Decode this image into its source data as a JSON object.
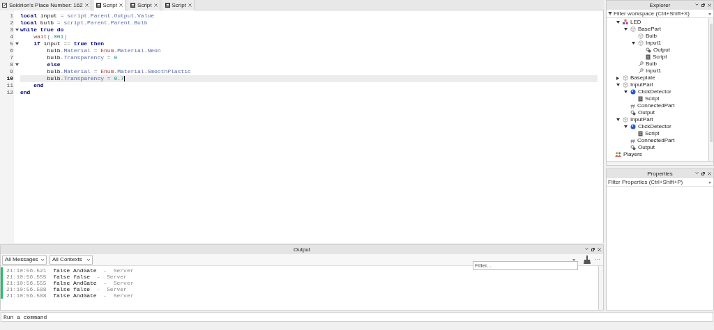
{
  "tabs": [
    {
      "label": "Soldrion's Place Number: 162",
      "kind": "place",
      "selected": false
    },
    {
      "label": "Script",
      "kind": "script",
      "selected": true
    },
    {
      "label": "Script",
      "kind": "script",
      "selected": false
    },
    {
      "label": "Script",
      "kind": "script",
      "selected": false
    }
  ],
  "editor": {
    "lines": [
      {
        "number": "1",
        "fold": false,
        "current": false,
        "tokens": [
          {
            "kind": "keyword",
            "text": "local"
          },
          {
            "kind": "plain",
            "text": " input "
          },
          {
            "kind": "op",
            "text": "="
          },
          {
            "kind": "member",
            "text": " script.Parent.Output.Value"
          }
        ]
      },
      {
        "number": "2",
        "fold": false,
        "current": false,
        "tokens": [
          {
            "kind": "keyword",
            "text": "local"
          },
          {
            "kind": "plain",
            "text": " bulb "
          },
          {
            "kind": "op",
            "text": "="
          },
          {
            "kind": "member",
            "text": " script.Parent.Parent.Bulb"
          }
        ]
      },
      {
        "number": "3",
        "fold": true,
        "current": false,
        "tokens": [
          {
            "kind": "keyword",
            "text": "while true do"
          }
        ]
      },
      {
        "number": "4",
        "fold": false,
        "current": false,
        "tokens": [
          {
            "kind": "builtin",
            "text": "    wait"
          },
          {
            "kind": "op",
            "text": "("
          },
          {
            "kind": "number",
            "text": ".001"
          },
          {
            "kind": "op",
            "text": ")"
          }
        ]
      },
      {
        "number": "5",
        "fold": true,
        "current": false,
        "tokens": [
          {
            "kind": "keyword",
            "text": "    if"
          },
          {
            "kind": "plain",
            "text": " input "
          },
          {
            "kind": "op",
            "text": "=="
          },
          {
            "kind": "keyword",
            "text": " true then"
          }
        ]
      },
      {
        "number": "6",
        "fold": false,
        "current": false,
        "tokens": [
          {
            "kind": "plain",
            "text": "        bulb"
          },
          {
            "kind": "member",
            "text": ".Material "
          },
          {
            "kind": "op",
            "text": "="
          },
          {
            "kind": "builtin",
            "text": " Enum"
          },
          {
            "kind": "member",
            "text": ".Material.Neon"
          }
        ]
      },
      {
        "number": "7",
        "fold": false,
        "current": false,
        "tokens": [
          {
            "kind": "plain",
            "text": "        bulb"
          },
          {
            "kind": "member",
            "text": ".Transparency "
          },
          {
            "kind": "op",
            "text": "="
          },
          {
            "kind": "number",
            "text": " 0"
          }
        ]
      },
      {
        "number": "8",
        "fold": true,
        "current": false,
        "tokens": [
          {
            "kind": "keyword",
            "text": "        else"
          }
        ]
      },
      {
        "number": "9",
        "fold": false,
        "current": false,
        "tokens": [
          {
            "kind": "plain",
            "text": "        bulb"
          },
          {
            "kind": "member",
            "text": ".Material "
          },
          {
            "kind": "op",
            "text": "="
          },
          {
            "kind": "builtin",
            "text": " Enum"
          },
          {
            "kind": "member",
            "text": ".Material.SmoothPlastic"
          }
        ]
      },
      {
        "number": "10",
        "fold": false,
        "current": true,
        "tokens": [
          {
            "kind": "plain",
            "text": "        bulb"
          },
          {
            "kind": "member",
            "text": ".Transparency "
          },
          {
            "kind": "op",
            "text": "="
          },
          {
            "kind": "number",
            "text": " 0.7"
          }
        ]
      },
      {
        "number": "11",
        "fold": false,
        "current": false,
        "tokens": [
          {
            "kind": "keyword",
            "text": "    end"
          }
        ]
      },
      {
        "number": "12",
        "fold": false,
        "current": false,
        "tokens": [
          {
            "kind": "keyword",
            "text": "end"
          }
        ]
      }
    ]
  },
  "output": {
    "title": "Output",
    "message_filter": "All Messages",
    "context_filter": "All Contexts",
    "filter_placeholder": "Filter...",
    "more": "···",
    "entries": [
      {
        "time": "21:10:56.521",
        "message": "false AndGate",
        "separator": "-",
        "source": "Server"
      },
      {
        "time": "21:10:56.555",
        "message": "false false",
        "separator": "-",
        "source": "Server"
      },
      {
        "time": "21:10:56.555",
        "message": "false AndGate",
        "separator": "-",
        "source": "Server"
      },
      {
        "time": "21:10:56.588",
        "message": "false false",
        "separator": "-",
        "source": "Server"
      },
      {
        "time": "21:10:56.588",
        "message": "false AndGate",
        "separator": "-",
        "source": "Server"
      }
    ]
  },
  "command_bar": {
    "placeholder": "Run a command"
  },
  "explorer": {
    "title": "Explorer",
    "filter_placeholder": "Filter workspace (Ctrl+Shift+X)",
    "workspace_children": [
      {
        "label": "LED",
        "kind": "model",
        "expanded": true,
        "children": [
          {
            "label": "BasePart",
            "kind": "part",
            "expanded": true,
            "children": [
              {
                "label": "Bulb",
                "kind": "part"
              },
              {
                "label": "Input1",
                "kind": "part",
                "expanded": true,
                "children": [
                  {
                    "label": "Output",
                    "kind": "value"
                  },
                  {
                    "label": "Script",
                    "kind": "script"
                  }
                ]
              },
              {
                "label": "Bulb",
                "kind": "weld"
              },
              {
                "label": "Input1",
                "kind": "weld"
              }
            ]
          }
        ]
      },
      {
        "label": "Baseplate",
        "kind": "part",
        "expanded": false
      },
      {
        "label": "InputPart",
        "kind": "part",
        "expanded": true,
        "children": [
          {
            "label": "ClickDetector",
            "kind": "click",
            "expanded": true,
            "children": [
              {
                "label": "Script",
                "kind": "script"
              }
            ]
          },
          {
            "label": "ConnectedPart",
            "kind": "object"
          },
          {
            "label": "Output",
            "kind": "value"
          }
        ]
      },
      {
        "label": "InputPart",
        "kind": "part",
        "expanded": true,
        "children": [
          {
            "label": "ClickDetector",
            "kind": "click",
            "expanded": true,
            "children": [
              {
                "label": "Script",
                "kind": "script"
              }
            ]
          },
          {
            "label": "ConnectedPart",
            "kind": "object"
          },
          {
            "label": "Output",
            "kind": "value"
          }
        ]
      }
    ],
    "services": [
      {
        "label": "Players",
        "kind": "players"
      }
    ]
  },
  "properties": {
    "title": "Properties",
    "filter_placeholder": "Filter Properties (Ctrl+Shift+P)"
  }
}
